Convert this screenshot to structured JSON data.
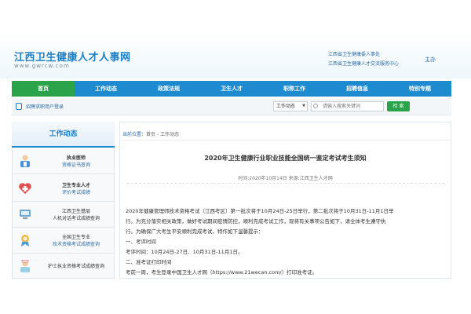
{
  "header": {
    "site_title": "江西卫生健康人才人事网",
    "site_url": "www.gwrcw.com",
    "host_line1": "江西省卫生健康委人事处",
    "host_line2": "江西省卫生健康人才交流服务中心",
    "host_tag": "主办"
  },
  "nav": {
    "items": [
      "首页",
      "工作动态",
      "政策法规",
      "卫生人才",
      "职称工作",
      "招聘信息",
      "特别专题"
    ]
  },
  "subbar": {
    "phone_link": "招聘求职用户登录",
    "select_value": "工作动态",
    "search_placeholder": "请输入搜索关键词",
    "search_button": "检 索"
  },
  "sidebar": {
    "title": "工作动态",
    "items": [
      {
        "line1": "执业医师",
        "line2": "资格证书查询"
      },
      {
        "line1": "卫生专业人才",
        "line2": "评价考试成绩"
      },
      {
        "line1": "江西卫生基层",
        "line2": "人机对话考试成绩查询"
      },
      {
        "line1": "全国卫生专业",
        "line2": "技术资格考试成绩查询"
      },
      {
        "line1": "护士执业资格考试成绩查询",
        "line2": ""
      }
    ]
  },
  "content": {
    "breadcrumb_label": "当前位置：",
    "breadcrumb_path": "首页 - 工作动态",
    "title": "2020年卫生健康行业职业技能全国统一鉴定考试考生须知",
    "meta": "时间:2020年10月14日 来源:江西卫生人才网",
    "paragraphs": [
      "2020年健康管理师技术资格考试（江西考区）第一批次将于10月24日-25日举行，第二批次将于10月31日-11月1日举",
      "行。为充分落实相关政策，做好考试期间疫情防控，顺利完成考试工作，现将有关事项公告如下，请全体考生遵守执",
      "行。为确保广大考生平安顺利完成考试，特作如下温馨提示：",
      "一、考评时间",
      "考评时间：10月24日-27日、10月31日-11月1日。",
      "二、准考证打印时间",
      "考前一周，考生登录中国卫生人才网（https://www.21wecan.com/）打印准考证。"
    ]
  }
}
